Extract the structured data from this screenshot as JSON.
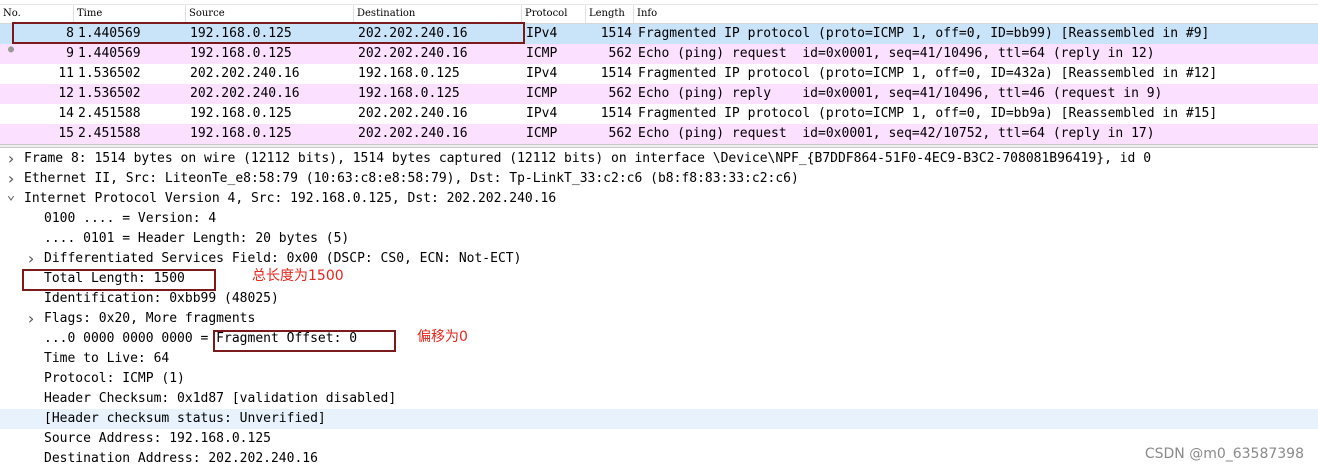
{
  "packet_list": {
    "columns": [
      "No.",
      "Time",
      "Source",
      "Destination",
      "Protocol",
      "Length",
      "Info"
    ],
    "rows": [
      {
        "no": "8",
        "time": "1.440569",
        "source": "192.168.0.125",
        "destination": "202.202.240.16",
        "protocol": "IPv4",
        "length": "1514",
        "info": "Fragmented IP protocol (proto=ICMP 1, off=0, ID=bb99) [Reassembled in #9]",
        "bg": "#c9e3f8",
        "selected": true
      },
      {
        "no": "9",
        "time": "1.440569",
        "source": "192.168.0.125",
        "destination": "202.202.240.16",
        "protocol": "ICMP",
        "length": "562",
        "info": "Echo (ping) request  id=0x0001, seq=41/10496, ttl=64 (reply in 12)",
        "bg": "#fce0ff",
        "selected": false
      },
      {
        "no": "11",
        "time": "1.536502",
        "source": "202.202.240.16",
        "destination": "192.168.0.125",
        "protocol": "IPv4",
        "length": "1514",
        "info": "Fragmented IP protocol (proto=ICMP 1, off=0, ID=432a) [Reassembled in #12]",
        "bg": "#ffffff",
        "selected": false
      },
      {
        "no": "12",
        "time": "1.536502",
        "source": "202.202.240.16",
        "destination": "192.168.0.125",
        "protocol": "ICMP",
        "length": "562",
        "info": "Echo (ping) reply    id=0x0001, seq=41/10496, ttl=46 (request in 9)",
        "bg": "#fce0ff",
        "selected": false
      },
      {
        "no": "14",
        "time": "2.451588",
        "source": "192.168.0.125",
        "destination": "202.202.240.16",
        "protocol": "IPv4",
        "length": "1514",
        "info": "Fragmented IP protocol (proto=ICMP 1, off=0, ID=bb9a) [Reassembled in #15]",
        "bg": "#ffffff",
        "selected": false
      },
      {
        "no": "15",
        "time": "2.451588",
        "source": "192.168.0.125",
        "destination": "202.202.240.16",
        "protocol": "ICMP",
        "length": "562",
        "info": "Echo (ping) request  id=0x0001, seq=42/10752, ttl=64 (reply in 17)",
        "bg": "#fce0ff",
        "selected": false
      }
    ]
  },
  "detail_tree": [
    {
      "text": "Frame 8: 1514 bytes on wire (12112 bits), 1514 bytes captured (12112 bits) on interface \\Device\\NPF_{B7DDF864-51F0-4EC9-B3C2-708081B96419}, id 0",
      "indent": 0,
      "arrow": "collapsed",
      "highlight": false
    },
    {
      "text": "Ethernet II, Src: LiteonTe_e8:58:79 (10:63:c8:e8:58:79), Dst: Tp-LinkT_33:c2:c6 (b8:f8:83:33:c2:c6)",
      "indent": 0,
      "arrow": "collapsed",
      "highlight": false
    },
    {
      "text": "Internet Protocol Version 4, Src: 192.168.0.125, Dst: 202.202.240.16",
      "indent": 0,
      "arrow": "expanded",
      "highlight": false
    },
    {
      "text": "0100 .... = Version: 4",
      "indent": 1,
      "arrow": "none",
      "highlight": false
    },
    {
      "text": ".... 0101 = Header Length: 20 bytes (5)",
      "indent": 1,
      "arrow": "none",
      "highlight": false
    },
    {
      "text": "Differentiated Services Field: 0x00 (DSCP: CS0, ECN: Not-ECT)",
      "indent": 1,
      "arrow": "collapsed",
      "highlight": false
    },
    {
      "text": "Total Length: 1500",
      "indent": 1,
      "arrow": "none",
      "highlight": false
    },
    {
      "text": "Identification: 0xbb99 (48025)",
      "indent": 1,
      "arrow": "none",
      "highlight": false
    },
    {
      "text": "Flags: 0x20, More fragments",
      "indent": 1,
      "arrow": "collapsed",
      "highlight": false
    },
    {
      "text": "...0 0000 0000 0000 = Fragment Offset: 0",
      "indent": 1,
      "arrow": "none",
      "highlight": false
    },
    {
      "text": "Time to Live: 64",
      "indent": 1,
      "arrow": "none",
      "highlight": false
    },
    {
      "text": "Protocol: ICMP (1)",
      "indent": 1,
      "arrow": "none",
      "highlight": false
    },
    {
      "text": "Header Checksum: 0x1d87 [validation disabled]",
      "indent": 1,
      "arrow": "none",
      "highlight": false
    },
    {
      "text": "[Header checksum status: Unverified]",
      "indent": 1,
      "arrow": "none",
      "highlight": true
    },
    {
      "text": "Source Address: 192.168.0.125",
      "indent": 1,
      "arrow": "none",
      "highlight": false
    },
    {
      "text": "Destination Address: 202.202.240.16",
      "indent": 1,
      "arrow": "none",
      "highlight": false
    }
  ],
  "annotations": {
    "total_length_note": "总长度为1500",
    "offset_note": "偏移为0"
  },
  "watermark": "CSDN @m0_63587398",
  "colors": {
    "selected_row": "#c9e3f8",
    "icmp_row": "#fce0ff",
    "highlight_row": "#e8f2fd",
    "annotation_box": "#7a1a1a",
    "annotation_text": "#e8261c"
  }
}
